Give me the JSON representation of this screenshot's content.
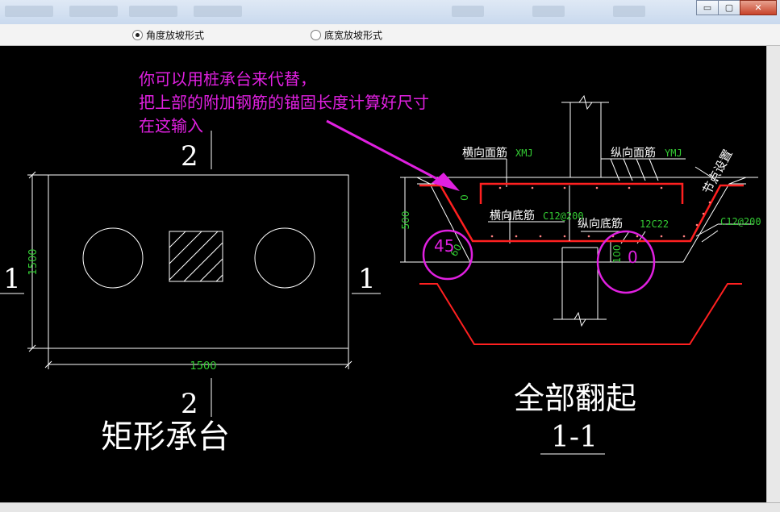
{
  "radio_options": [
    {
      "label": "角度放坡形式",
      "selected": true
    },
    {
      "label": "底宽放坡形式",
      "selected": false
    }
  ],
  "window_controls": {
    "minimize": "▭",
    "restore": "▢",
    "close": "✕"
  },
  "annotation": {
    "lines": [
      "你可以用桩承台来代替，",
      "把上部的附加钢筋的锚固长度计算好尺寸",
      "在这输入"
    ],
    "color": "#e020e0"
  },
  "plan": {
    "title": "矩形承台",
    "width_dim": "1500",
    "height_dim": "1500",
    "section_left": "1",
    "section_right": "1",
    "section_top": "2",
    "section_bottom": "2"
  },
  "section": {
    "title": "全部翻起",
    "subtitle": "1-1",
    "labels": {
      "top_transverse": "横向面筋",
      "top_transverse_code": "XMJ",
      "top_longitudinal": "纵向面筋",
      "top_longitudinal_code": "YMJ",
      "bottom_transverse": "横向底筋",
      "bottom_transverse_code": "C12@200",
      "bottom_longitudinal": "纵向底筋",
      "bottom_longitudinal_code": "12C22",
      "node_setting": "节点设置",
      "side_code": "C12@200",
      "depth": "500",
      "cover": "100",
      "zero_small": "0",
      "angle": "60",
      "circled_left": "45",
      "circled_right": "0"
    }
  },
  "colors": {
    "rebar": "#ff2020",
    "dim": "#33cc33",
    "line": "#ffffff",
    "highlight": "#e020e0"
  }
}
